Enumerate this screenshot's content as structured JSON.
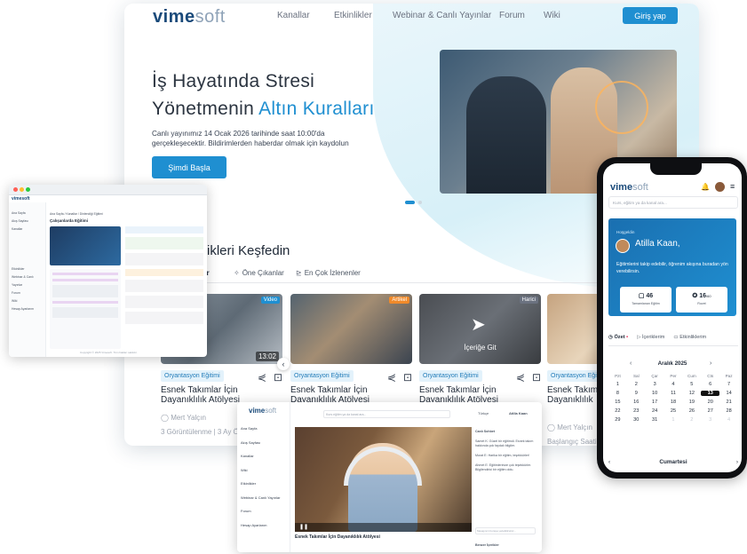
{
  "main": {
    "logo": {
      "bold": "vime",
      "light": "soft"
    },
    "nav": [
      "Kanallar",
      "Etkinlikler",
      "Webinar & Canlı Yayınlar",
      "Forum",
      "Wiki"
    ],
    "login_label": "Giriş yap",
    "hero": {
      "title_line1": "İş Hayatında Stresi",
      "title_line2_plain": "Yönetmenin ",
      "title_line2_accent": "Altın Kuralları",
      "description": "Canlı yayınımız 14 Ocak 2026 tarihinde saat 10:00'da gerçekleşecektir. Bildirimlerden haberdar olmak için kaydolun",
      "cta": "Şimdi Başla"
    },
    "section_title": "rikleri Keşfedin",
    "tabs": [
      {
        "label": "ar",
        "icon": ""
      },
      {
        "label": "Öne Çıkanlar",
        "icon": "✧"
      },
      {
        "label": "En Çok İzlenenler",
        "icon": "⊵"
      }
    ],
    "cards": [
      {
        "badge": "Video",
        "badge_color": "#1f8fd1",
        "duration": "13:02",
        "tag": "Oryantasyon Eğitimi",
        "title": "Esnek Takımlar İçin Dayanıklılık Atölyesi",
        "author": "Mert Yalçın",
        "meta": "3 Görüntülenme | 3 Ay Önce Eklendi",
        "overlay": ""
      },
      {
        "badge": "Artikel",
        "badge_color": "#f08a2a",
        "duration": "",
        "tag": "Oryantasyon Eğitimi",
        "title": "Esnek Takımlar İçin Dayanıklılık Atölyesi",
        "author": "",
        "meta": "",
        "overlay": ""
      },
      {
        "badge": "Harici",
        "badge_color": "#6b7280",
        "duration": "",
        "tag": "Oryantasyon Eğitimi",
        "title": "Esnek Takımlar İçin Dayanıklılık Atölyesi",
        "author": "",
        "meta": "",
        "overlay": "İçeriğe Git"
      },
      {
        "badge": "",
        "badge_color": "",
        "duration": "",
        "tag": "Oryantasyon Eğitimi",
        "title": "Esnek Takımlar İçin Dayanıklılık",
        "author": "Mert Yalçın",
        "meta": "Başlangıç Saati: 15 Kas",
        "overlay": ""
      }
    ]
  },
  "small_window": {
    "logo": "vimesoft",
    "breadcrumb": "Ana Sayfa  /  Kanallar  /  Dinlendiği Eğitimi",
    "page_title": "Çalışanlarda Eğitimi",
    "sidebar": [
      "Ana Sayfa",
      "Akış Sayfası",
      "Kanallar",
      "Etkinlikler",
      "Webinar & Canlı Yayınlar",
      "Forum",
      "Wiki",
      "Hesap Ayarlarım"
    ],
    "copyright": "Copyright © 2025 Vimesoft. Tüm hakları saklıdır."
  },
  "video_window": {
    "logo": {
      "bold": "vime",
      "light": "soft"
    },
    "search_placeholder": "Kurs eğitim ya da kanal ara...",
    "user_name": "Atilla Kaan",
    "lang": "Türkçe",
    "sidebar": [
      "Ana Sayfa",
      "Akış Sayfası",
      "Kanallar",
      "Wiki",
      "Etkinlikler",
      "Webinar & Canlı Yayınlar",
      "Forum",
      "Hesap Ayarlarım"
    ],
    "video_title": "Esnek Takımlar İçin Dayanıklılık Atölyesi",
    "chat_title": "Canlı Sohbet",
    "chat": [
      "Samet K: Güzel bir eğitimdi. Esnek takım hakkında çok faydalı bilgiler.",
      "Murat E: Harika bir eğitim, teşekkürler!",
      "Ahmet E: Eğitimlerinize çok teşekkürler. Bilgilendirici bir eğitim oldu."
    ],
    "chat_placeholder": "Mesajınızı buraya yazabilirsiniz...",
    "next_label": "Benzer İçerikler"
  },
  "phone": {
    "logo": {
      "bold": "vime",
      "light": "soft"
    },
    "search_placeholder": "Kurs, eğitim ya da kanal ara...",
    "greeting": "Hoşgeldin",
    "name": "Atilla Kaan,",
    "message": "Eğitimlerini takip edebilir, öğrenim akışına buradan yön verebilirsin.",
    "stats": [
      {
        "value": "46",
        "label": "Tamamlanan Eğitim"
      },
      {
        "value": "16",
        "unit": "60",
        "label": "Rozet"
      }
    ],
    "tabs": [
      "Özet",
      "İçeriklerim",
      "Etkinliklerim"
    ],
    "calendar": {
      "month": "Aralık 2025",
      "days": [
        "Pzt",
        "Sal",
        "Çar",
        "Per",
        "Cum",
        "Cts",
        "Paz"
      ],
      "weeks": [
        [
          "1",
          "2",
          "3",
          "4",
          "5",
          "6",
          "7"
        ],
        [
          "8",
          "9",
          "10",
          "11",
          "12",
          "13",
          "14"
        ],
        [
          "15",
          "16",
          "17",
          "18",
          "19",
          "20",
          "21"
        ],
        [
          "22",
          "23",
          "24",
          "25",
          "26",
          "27",
          "28"
        ],
        [
          "29",
          "30",
          "31",
          "1",
          "2",
          "3",
          "4"
        ]
      ],
      "today": "13",
      "footer_day": "Cumartesi"
    }
  }
}
